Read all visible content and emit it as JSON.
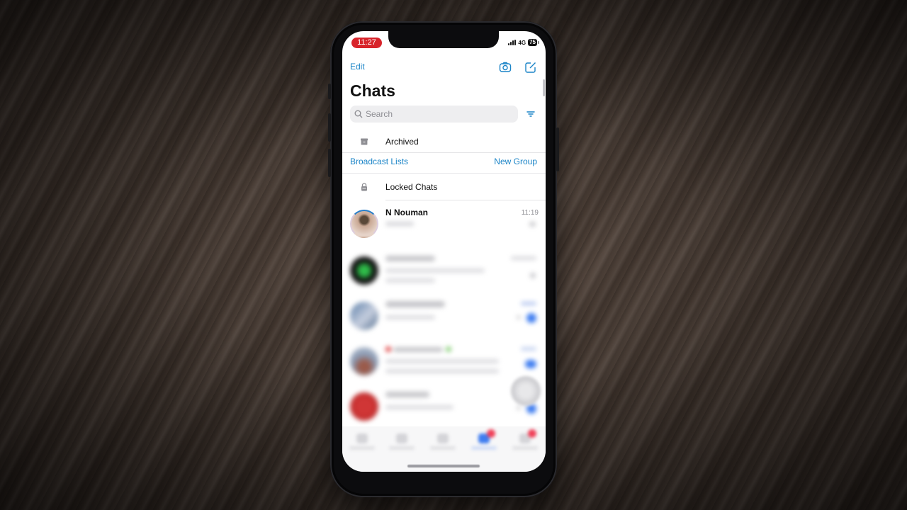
{
  "status_bar": {
    "time": "11:27",
    "network": "4G",
    "battery": "75"
  },
  "header": {
    "edit_label": "Edit",
    "camera_icon": "camera-icon",
    "compose_icon": "compose-icon",
    "title": "Chats"
  },
  "search": {
    "placeholder": "Search",
    "value": "",
    "filter_icon": "filter-icon"
  },
  "archived": {
    "label": "Archived",
    "icon": "archive-box-icon"
  },
  "links": {
    "broadcast_lists": "Broadcast Lists",
    "new_group": "New Group"
  },
  "locked": {
    "label": "Locked Chats",
    "icon": "lock-icon"
  },
  "chats": [
    {
      "name": "N Nouman",
      "time": "11:19",
      "preview": "",
      "blurred": false,
      "has_status_ring": true
    },
    {
      "name": "",
      "time": "",
      "preview": "",
      "blurred": true,
      "avatar_color": "#1a1a1a",
      "accent": "#2fbf4a"
    },
    {
      "name": "",
      "time": "",
      "preview": "",
      "blurred": true,
      "avatar_color": "#6f8aa8",
      "unread": true
    },
    {
      "name": "",
      "time": "",
      "preview": "",
      "blurred": true,
      "avatar_color": "#8a9bb4",
      "unread": true
    },
    {
      "name": "",
      "time": "",
      "preview": "",
      "blurred": true,
      "avatar_color": "#c82a2a",
      "unread": true
    }
  ],
  "tabbar": {
    "tabs": [
      {
        "icon": "updates-icon",
        "badge": false
      },
      {
        "icon": "calls-icon",
        "badge": false
      },
      {
        "icon": "communities-icon",
        "badge": false
      },
      {
        "icon": "chats-icon",
        "badge": true,
        "active": true
      },
      {
        "icon": "settings-icon",
        "badge": true
      }
    ]
  },
  "colors": {
    "accent": "#1a84c7",
    "time_pill": "#d8242b",
    "unread_badge": "#3f7df0",
    "tab_badge": "#f0425a"
  }
}
